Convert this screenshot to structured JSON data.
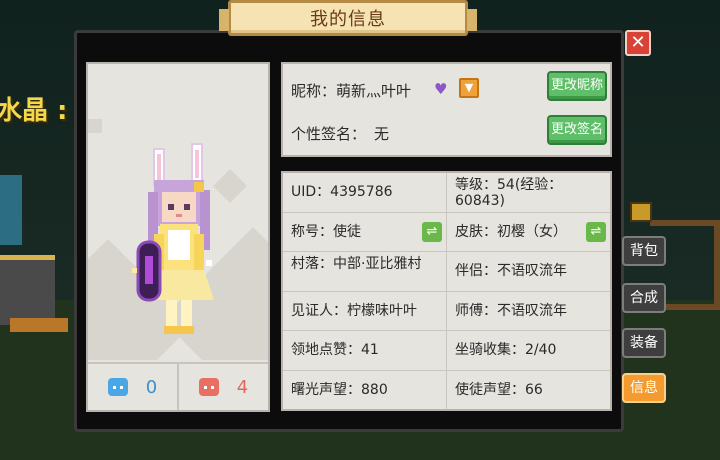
{
  "background": {
    "world_text": "水晶 :"
  },
  "window": {
    "title": "我的信息",
    "close_label": "✕"
  },
  "stats": {
    "likes": {
      "icon": "happy-face-icon",
      "value": "0",
      "color": "#3d8fd0"
    },
    "dislikes": {
      "icon": "sad-face-icon",
      "value": "4",
      "color": "#e0675c"
    }
  },
  "profile": {
    "nickname_label": "昵称：",
    "nickname": "萌新灬叶叶",
    "heart_icon": "♥",
    "expand_icon": "▼",
    "signature_label": "个性签名：",
    "signature": "无",
    "change_nickname_button": "更改昵称",
    "change_signature_button": "更改签名"
  },
  "info_rows": [
    {
      "left": "UID：4395786",
      "right": "等级：54(经验：60843)"
    },
    {
      "left": "称号：使徒",
      "right": "皮肤：初樱（女）"
    },
    {
      "left": "村落：中部·亚比雅村",
      "right": "伴侣：不语叹流年"
    },
    {
      "left": "见证人：柠檬味叶叶",
      "right": "师傅：不语叹流年"
    },
    {
      "left": "领地点赞：41",
      "right": "坐骑收集：2/40"
    },
    {
      "left": "曙光声望：880",
      "right": "使徒声望：66"
    }
  ],
  "swap_icon": "⇌",
  "side_tabs": [
    {
      "label": "背包",
      "active": false
    },
    {
      "label": "合成",
      "active": false
    },
    {
      "label": "装备",
      "active": false
    },
    {
      "label": "信息",
      "active": true
    }
  ],
  "colors": {
    "accent_green": "#5fbf69",
    "active_tab": "#f39b2e",
    "close_red": "#d84336",
    "panel": "#e6e4df"
  }
}
